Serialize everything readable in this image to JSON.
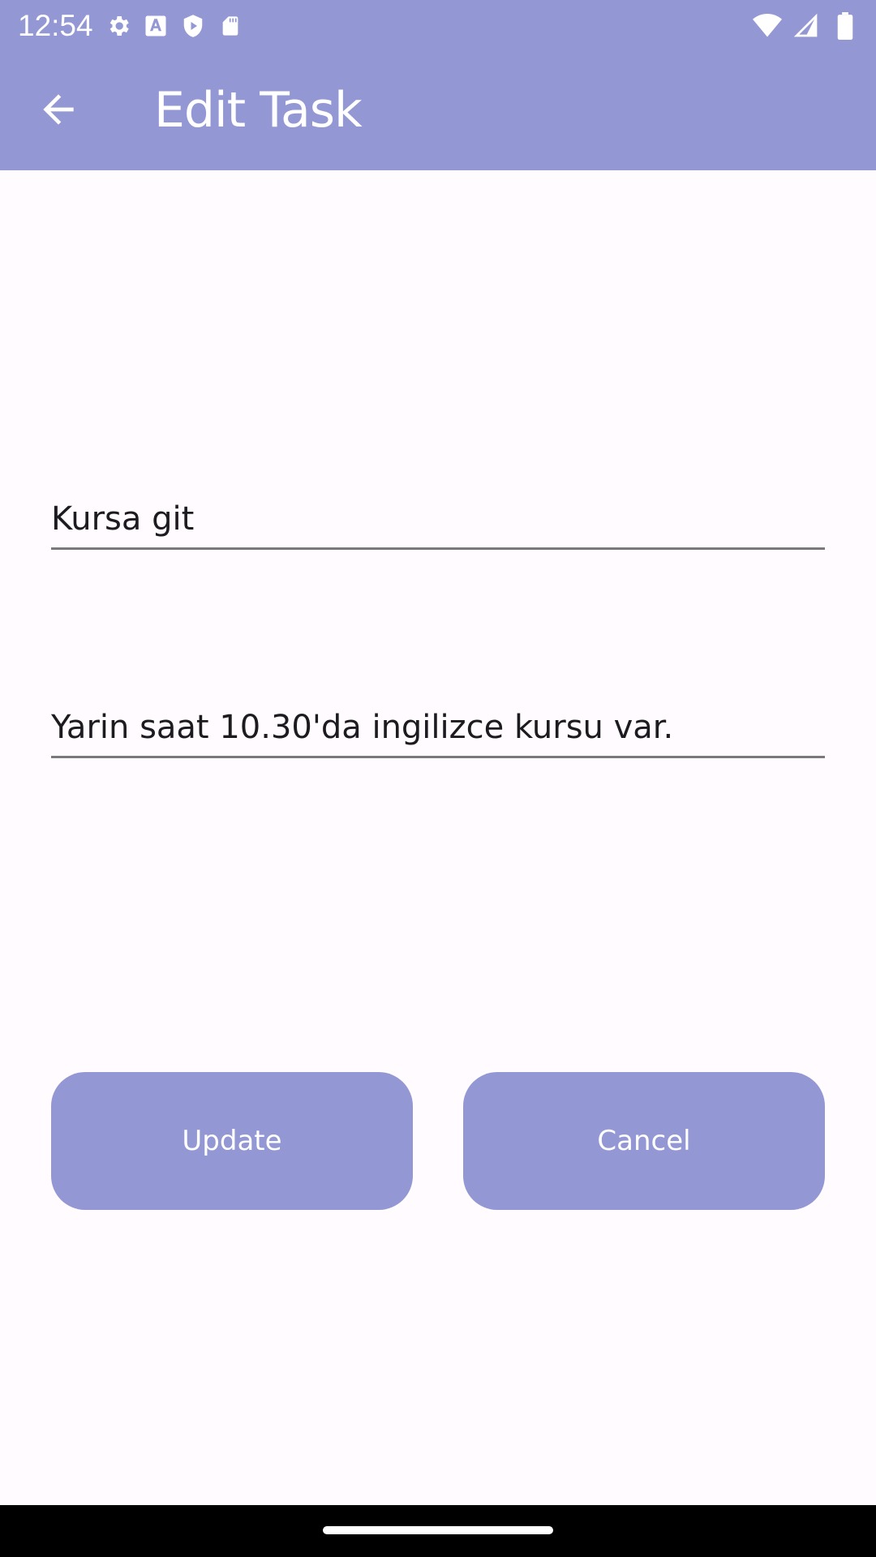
{
  "status_bar": {
    "time": "12:54",
    "left_icons": [
      "gear-icon",
      "font-a-icon",
      "shield-play-icon",
      "sd-card-icon"
    ],
    "right_icons": [
      "wifi-icon",
      "signal-icon",
      "battery-icon"
    ]
  },
  "app_bar": {
    "title": "Edit Task",
    "back_icon": "arrow-back-icon",
    "background": "#9397d4"
  },
  "form": {
    "title_value": "Kursa git",
    "description_value": "Yarin saat 10.30'da ingilizce kursu var."
  },
  "buttons": {
    "update_label": "Update",
    "cancel_label": "Cancel",
    "color": "#9397d4"
  }
}
